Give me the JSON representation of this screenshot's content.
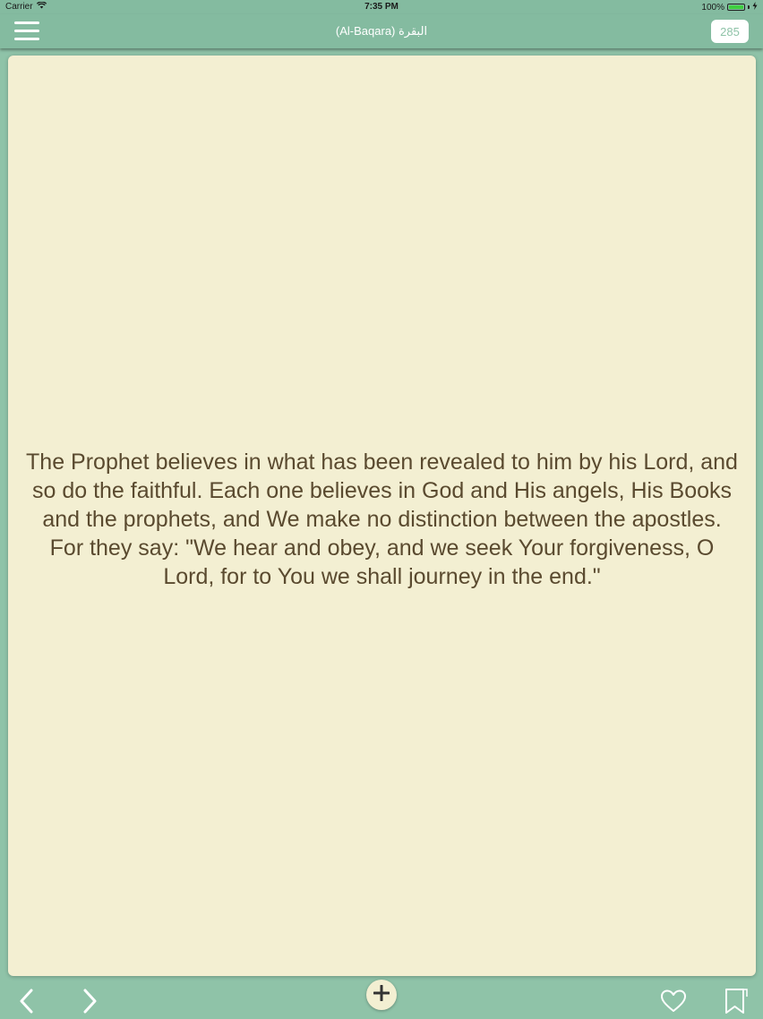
{
  "status_bar": {
    "carrier": "Carrier",
    "time": "7:35 PM",
    "battery": "100%"
  },
  "nav_bar": {
    "title": "(Al-Baqara) البقرة",
    "verse_number": "285"
  },
  "content": {
    "verse_text": "The Prophet believes in what has been revealed to him by his Lord, and so do the faithful. Each one believes in God and His angels, His Books and the prophets, and We make no distinction between the apostles. For they say: \"We hear and obey, and we seek Your forgiveness, O Lord, for to You we shall journey in the end.\""
  },
  "icons": {
    "menu": "hamburger-menu-icon",
    "previous": "chevron-left-icon",
    "next": "chevron-right-icon",
    "add": "plus-icon",
    "favorite": "heart-icon",
    "bookmark": "bookmark-icon"
  },
  "colors": {
    "bar_background": "#84bba0",
    "toolbar_background": "#8fc3a8",
    "card_background": "#f3efd2",
    "text_color": "#5a4a2f",
    "badge_text": "#8fc3a8"
  }
}
